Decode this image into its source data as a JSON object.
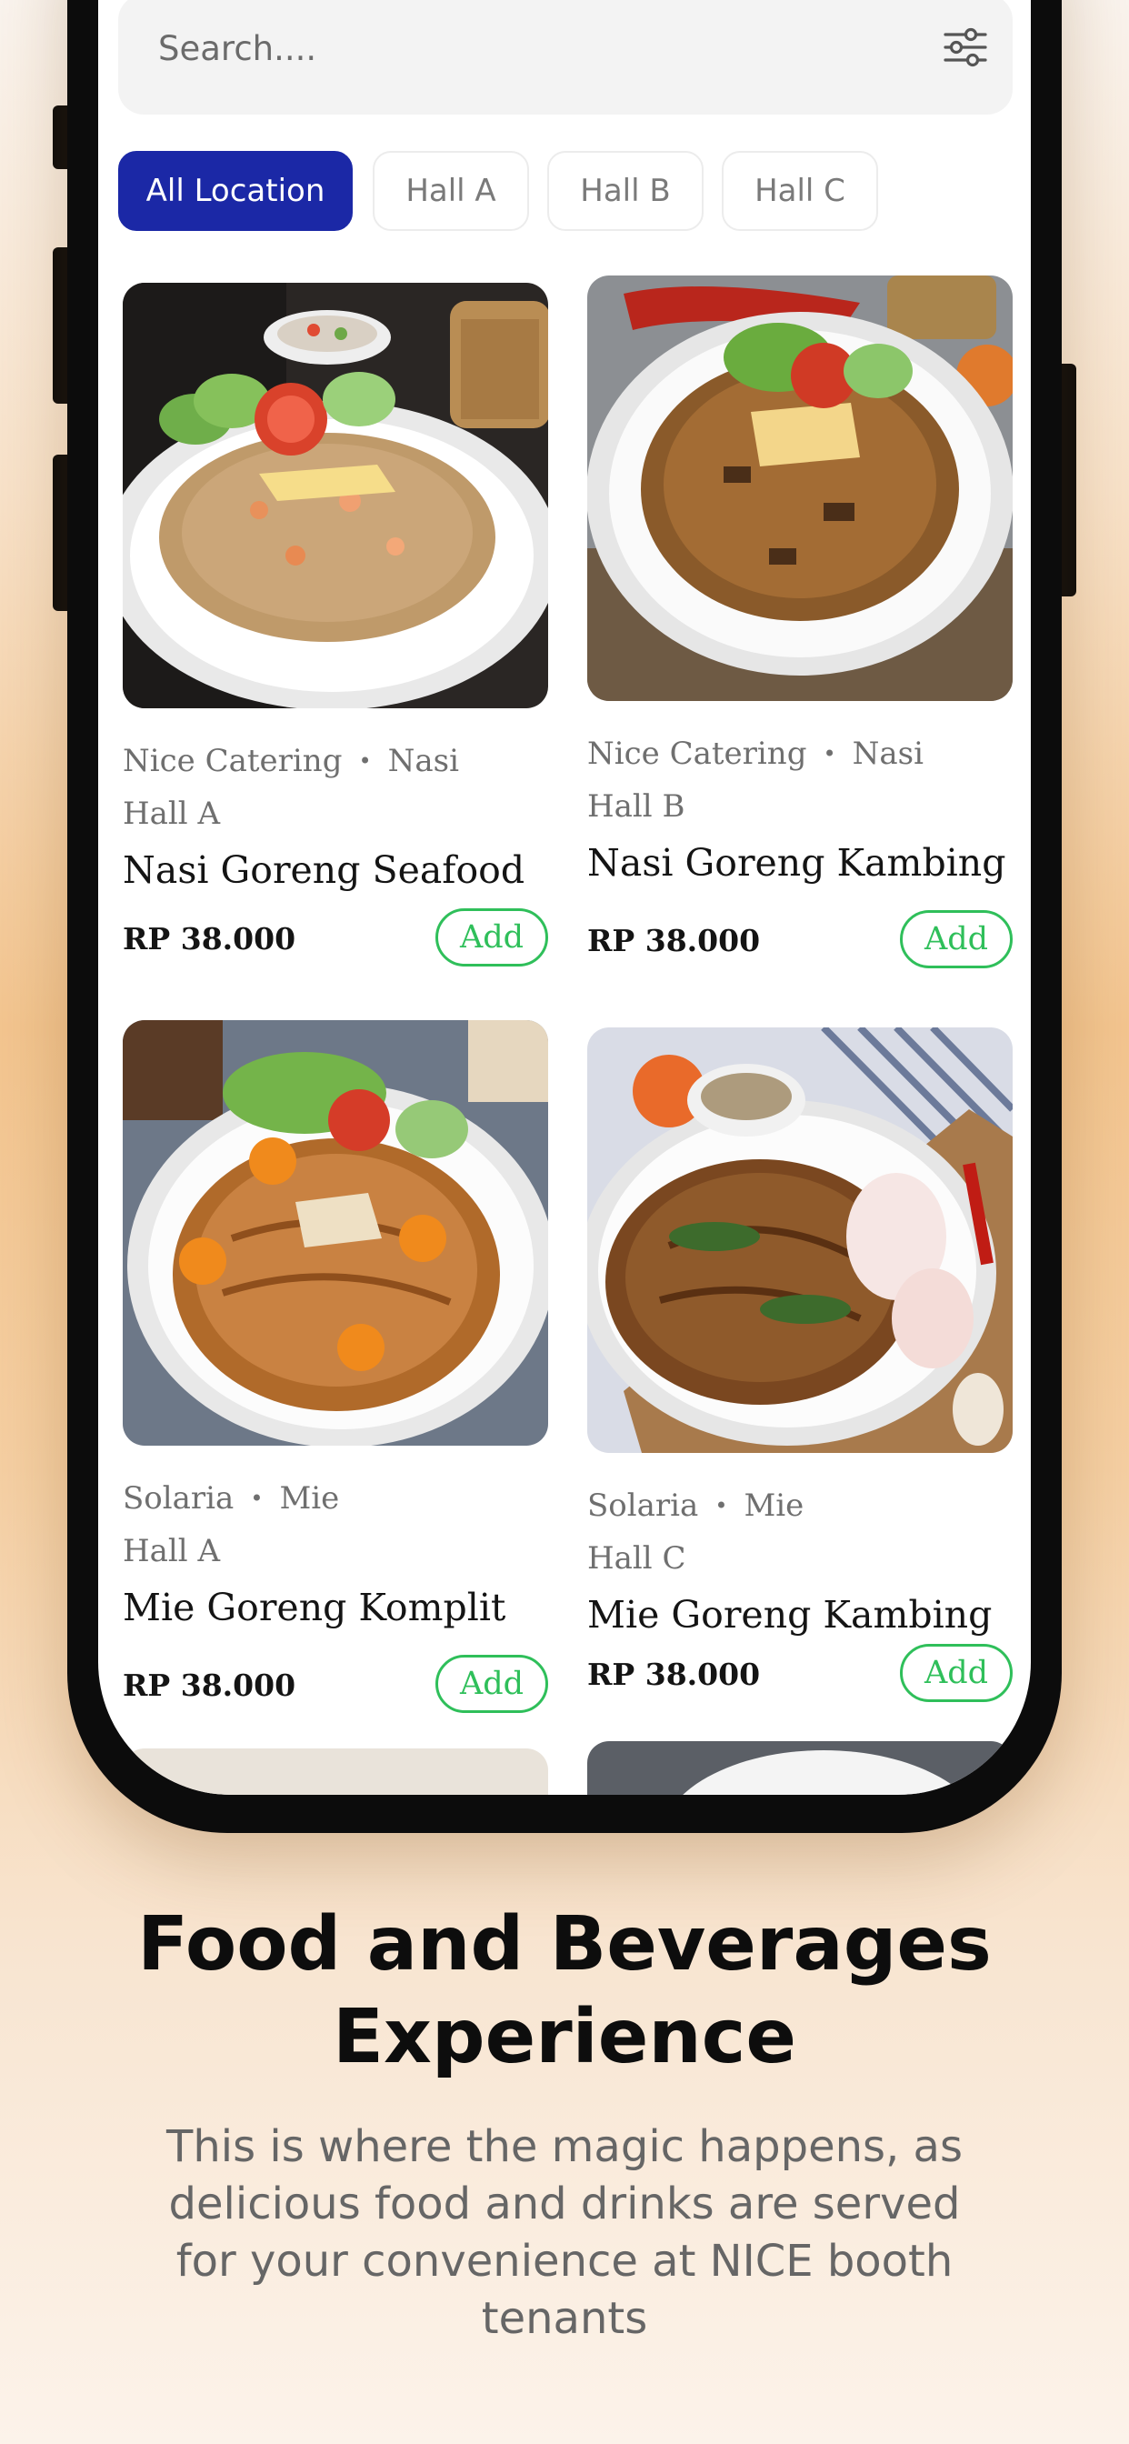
{
  "search": {
    "placeholder": "Search...."
  },
  "filters": [
    {
      "label": "All Location",
      "active": true
    },
    {
      "label": "Hall A",
      "active": false
    },
    {
      "label": "Hall B",
      "active": false
    },
    {
      "label": "Hall C",
      "active": false
    }
  ],
  "items": [
    {
      "vendor": "Nice Catering",
      "category": "Nasi",
      "hall": "Hall A",
      "name": "Nasi Goreng Seafood",
      "price": "RP 38.000",
      "add_label": "Add"
    },
    {
      "vendor": "Nice Catering",
      "category": "Nasi",
      "hall": "Hall B",
      "name": "Nasi Goreng Kambing",
      "price": "RP 38.000",
      "add_label": "Add"
    },
    {
      "vendor": "Solaria",
      "category": "Mie",
      "hall": "Hall A",
      "name": "Mie Goreng Komplit",
      "price": "RP 38.000",
      "add_label": "Add"
    },
    {
      "vendor": "Solaria",
      "category": "Mie",
      "hall": "Hall C",
      "name": "Mie Goreng Kambing",
      "price": "RP 38.000",
      "add_label": "Add"
    }
  ],
  "promo": {
    "title": "Food and Beverages Experience",
    "description": "This is where the magic happens, as delicious food and drinks are served for your convenience at NICE booth tenants"
  },
  "colors": {
    "accent": "#1b28a6",
    "add_green": "#2fbf5a",
    "background_peach": "#f3c58f"
  },
  "icons": {
    "filter": "sliders-icon",
    "separator": "dot"
  }
}
